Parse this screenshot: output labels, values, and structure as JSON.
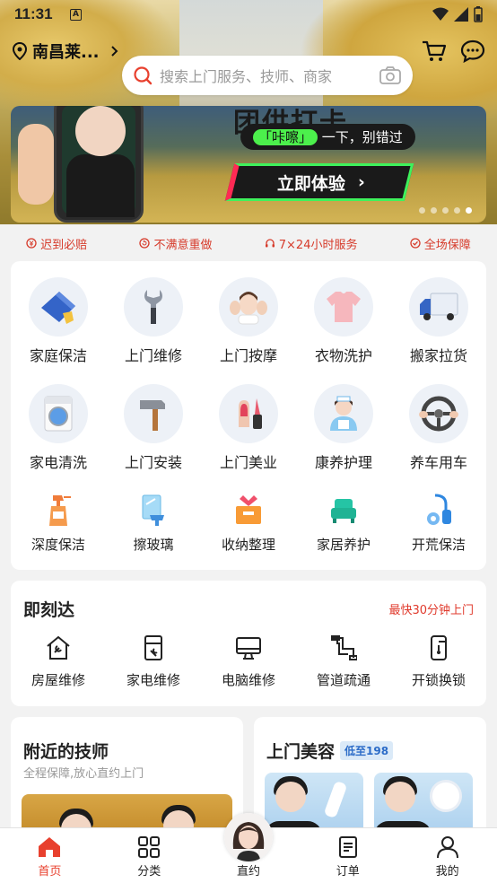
{
  "status_bar": {
    "time": "11:31",
    "notif": "A"
  },
  "header": {
    "location": "南昌莱...",
    "search_placeholder": "搜索上门服务、技师、商家"
  },
  "banner": {
    "headline": "团供打卡",
    "pill_highlight": "「咔嚓」",
    "pill_text": "一下，别错过",
    "cta": "立即体验"
  },
  "guarantees": [
    "迟到必赔",
    "不满意重做",
    "7×24小时服务",
    "全场保障"
  ],
  "categories": {
    "row1": [
      "家庭保洁",
      "上门维修",
      "上门按摩",
      "衣物洗护",
      "搬家拉货"
    ],
    "row2": [
      "家电清洗",
      "上门安装",
      "上门美业",
      "康养护理",
      "养车用车"
    ],
    "row3": [
      "深度保洁",
      "擦玻璃",
      "收纳整理",
      "家居养护",
      "开荒保洁"
    ]
  },
  "instant": {
    "title": "即刻达",
    "note": "最快30分钟上门",
    "items": [
      "房屋维修",
      "家电维修",
      "电脑维修",
      "管道疏通",
      "开锁换锁"
    ]
  },
  "nearby": {
    "title": "附近的技师",
    "subtitle": "全程保障,放心直约上门"
  },
  "beauty": {
    "title": "上门美容",
    "tag": "低至198"
  },
  "tabs": [
    "首页",
    "分类",
    "直约",
    "订单",
    "我的"
  ],
  "colors": {
    "accent": "#e8402e",
    "tag_blue": "#2c6cc8",
    "note_red": "#e03a2c"
  }
}
